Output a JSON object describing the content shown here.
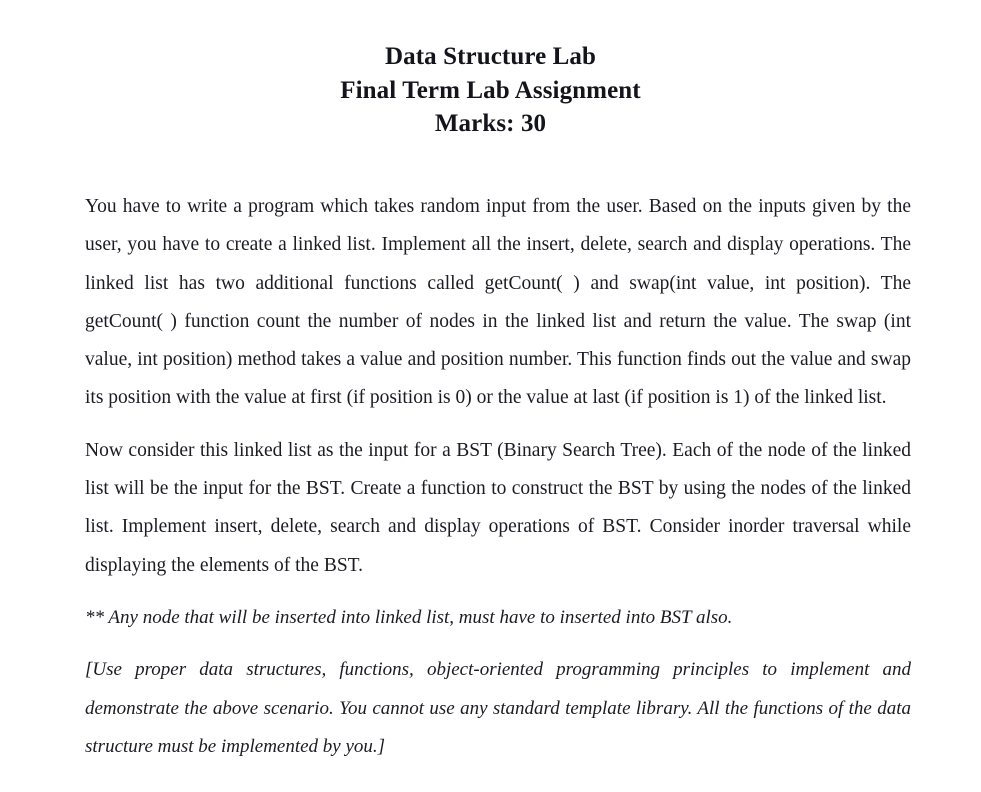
{
  "document": {
    "heading": {
      "line1": "Data Structure Lab",
      "line2": "Final Term Lab Assignment",
      "line3": "Marks: 30"
    },
    "paragraphs": [
      {
        "id": "linked-list-requirements",
        "style": "normal",
        "text": "You have to write a program which takes random input from the user. Based on the inputs given by the user, you have to create a linked list. Implement all the insert, delete, search and display operations. The linked list has two additional functions called getCount( ) and swap(int value, int position). The getCount( ) function count the number of nodes in the linked list and return the value. The swap (int value, int position) method takes a value and position number. This function finds out the value and swap its position with the value at first (if position is 0) or the value at last (if position is 1) of the linked list."
      },
      {
        "id": "bst-requirements",
        "style": "normal",
        "text": "Now consider this linked list as the input for a BST (Binary Search Tree). Each of the node of the linked list will be the input for the BST. Create a function to construct the BST by using the nodes of the linked list. Implement insert, delete, search and display operations of BST. Consider inorder traversal while displaying the elements of the BST."
      },
      {
        "id": "note-insert-into-bst",
        "style": "italic",
        "text": "** Any node that will be inserted into linked list, must have to inserted into BST also."
      },
      {
        "id": "instructions-bracketed",
        "style": "italic",
        "text": "[Use proper data structures, functions, object-oriented programming principles to implement and demonstrate the above scenario. You cannot use any standard template library. All the functions of the data structure must be implemented by you.]"
      }
    ]
  },
  "colors": {
    "page_background": "#ffffff",
    "text": "#1b1b24",
    "heading_text": "#14141c"
  }
}
